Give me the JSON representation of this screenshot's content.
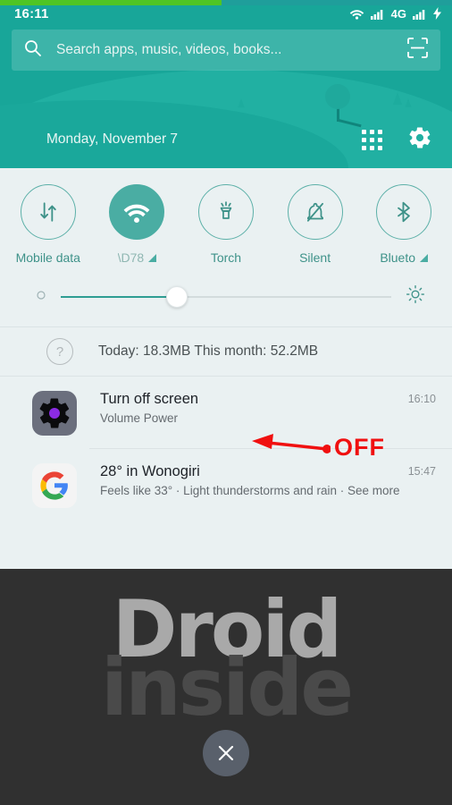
{
  "statusbar": {
    "clock": "16:11",
    "network_label": "4G",
    "icons": [
      "wifi-icon",
      "signal-bars-icon",
      "signal-bars-2-icon",
      "charging-bolt-icon"
    ]
  },
  "progress": {
    "percent": 49,
    "color": "#4fc524"
  },
  "search": {
    "placeholder": "Search apps, music, videos, books...",
    "value": "",
    "search_icon": "search-icon",
    "lens_icon": "lens-scan-icon"
  },
  "header": {
    "date": "Monday, November 7",
    "apps_icon": "app-grid-icon",
    "settings_icon": "gear-icon",
    "bg_color": "#18a699"
  },
  "quick_settings": {
    "toggles": [
      {
        "label": "Mobile data",
        "icon": "data-transfer-icon",
        "active": false,
        "has_caret": false,
        "faded": false
      },
      {
        "label": "\\D78",
        "icon": "wifi-icon",
        "active": true,
        "has_caret": true,
        "faded": true
      },
      {
        "label": "Torch",
        "icon": "flashlight-icon",
        "active": false,
        "has_caret": false,
        "faded": false
      },
      {
        "label": "Silent",
        "icon": "bell-muted-icon",
        "active": false,
        "has_caret": false,
        "faded": false
      },
      {
        "label": "Blueto",
        "icon": "bluetooth-icon",
        "active": false,
        "has_caret": true,
        "faded": false
      }
    ],
    "accent_color": "#3e9289",
    "active_color": "#4aada3"
  },
  "brightness": {
    "value_percent": 35,
    "low_icon": "brightness-low-icon",
    "high_icon": "brightness-high-icon"
  },
  "data_usage": {
    "help_icon": "help-question-icon",
    "text": "Today: 18.3MB   This month: 52.2MB"
  },
  "notifications": [
    {
      "icon": "gear-app-icon",
      "title": "Turn off screen",
      "subtitle": "Volume Power",
      "time": "16:10"
    },
    {
      "icon": "google-logo-icon",
      "title": "28° in Wonogiri",
      "subtitle": "Feels like 33° · Light thunderstorms and rain · See more",
      "time": "15:47"
    }
  ],
  "annotation": {
    "label": "OFF",
    "color": "#f01010",
    "arrow_icon": "arrow-left-annotation-icon"
  },
  "watermark": {
    "line1": "Droid",
    "line2": "inside"
  },
  "clear_all": {
    "icon": "close-x-icon",
    "label": ""
  }
}
